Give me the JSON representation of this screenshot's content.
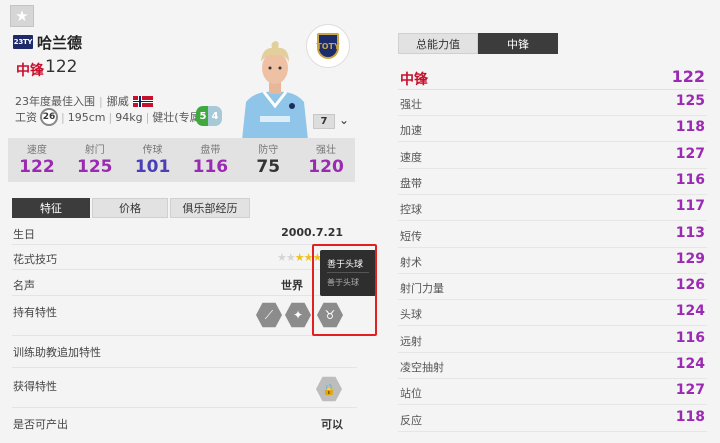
{
  "player": {
    "season_badge": "23TY",
    "name": "哈兰德",
    "position": "中锋",
    "position_rating": "122",
    "season_award": "23年度最佳入围",
    "nationality": "挪威",
    "salary_label": "工资",
    "salary": "26",
    "height": "195cm",
    "weight": "94kg",
    "body_type": "健壮(专属)",
    "weak_foot_left": "5",
    "weak_foot_right": "4",
    "enhance_level": "7",
    "club_logo_text": "TOTY"
  },
  "stats": [
    {
      "label": "速度",
      "value": "122",
      "color": "#9b2ab3"
    },
    {
      "label": "射门",
      "value": "125",
      "color": "#9b2ab3"
    },
    {
      "label": "传球",
      "value": "101",
      "color": "#4a3fb5"
    },
    {
      "label": "盘带",
      "value": "116",
      "color": "#9b2ab3"
    },
    {
      "label": "防守",
      "value": "75",
      "color": "#333333"
    },
    {
      "label": "强壮",
      "value": "120",
      "color": "#9b2ab3"
    }
  ],
  "tabs": [
    "特征",
    "价格",
    "俱乐部经历"
  ],
  "details": {
    "birth_label": "生日",
    "birth_value": "2000.7.21",
    "skill_label": "花式技巧",
    "skill_stars": 3,
    "fame_label": "名声",
    "fame_value": "世界",
    "traits_label": "持有特性",
    "training_label": "训练助教追加特性",
    "acquired_label": "获得特性",
    "producible_label": "是否可产出",
    "producible_value": "可以"
  },
  "tooltip": {
    "title": "善于头球",
    "subtitle": "善于头球"
  },
  "right_tabs": [
    "总能力值",
    "中锋"
  ],
  "attributes_header": {
    "label": "中锋",
    "value": "122"
  },
  "attributes": [
    {
      "label": "强壮",
      "value": "125",
      "color": "#9b2ab3"
    },
    {
      "label": "加速",
      "value": "118",
      "color": "#9b2ab3"
    },
    {
      "label": "速度",
      "value": "127",
      "color": "#9b2ab3"
    },
    {
      "label": "盘带",
      "value": "116",
      "color": "#9b2ab3"
    },
    {
      "label": "控球",
      "value": "117",
      "color": "#9b2ab3"
    },
    {
      "label": "短传",
      "value": "113",
      "color": "#9b2ab3"
    },
    {
      "label": "射术",
      "value": "129",
      "color": "#9b2ab3"
    },
    {
      "label": "射门力量",
      "value": "126",
      "color": "#9b2ab3"
    },
    {
      "label": "头球",
      "value": "124",
      "color": "#9b2ab3"
    },
    {
      "label": "远射",
      "value": "116",
      "color": "#9b2ab3"
    },
    {
      "label": "凌空抽射",
      "value": "124",
      "color": "#9b2ab3"
    },
    {
      "label": "站位",
      "value": "127",
      "color": "#9b2ab3"
    },
    {
      "label": "反应",
      "value": "118",
      "color": "#9b2ab3"
    }
  ],
  "icons": {
    "favorite": "star-icon",
    "trait_1": "finesse-shot-icon",
    "trait_2": "flair-icon",
    "trait_3": "header-bull-icon",
    "locked": "lock-icon"
  }
}
